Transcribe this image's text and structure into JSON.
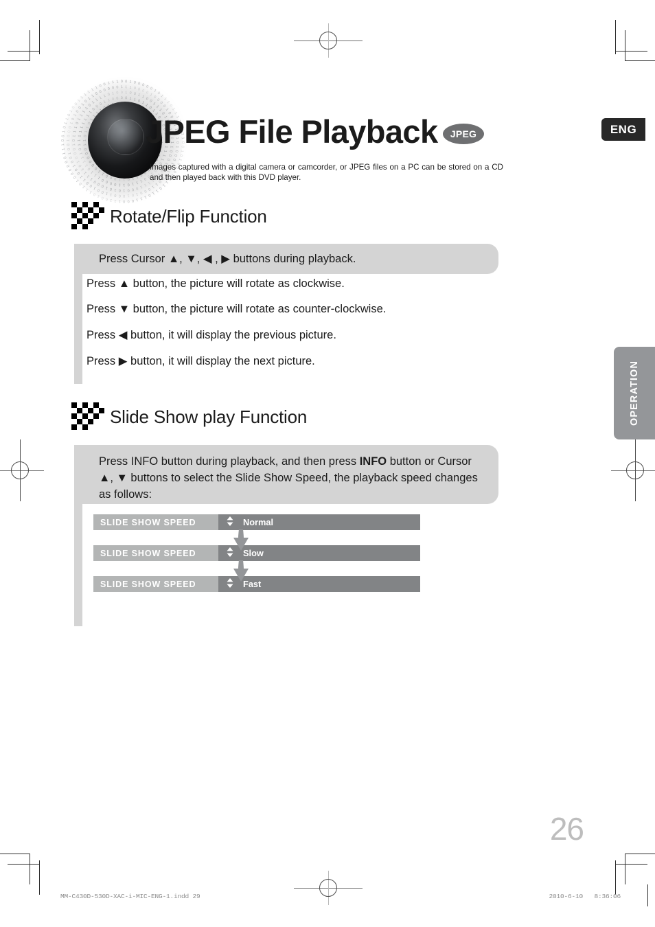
{
  "page": {
    "language_badge": "ENG",
    "side_tab_label": "OPERATION",
    "page_number": "26",
    "footer_file": "MM-C430D-530D-XAC-i-MIC-ENG-1.indd   29",
    "footer_date": "2010-6-10",
    "footer_time": "8:36:06"
  },
  "header": {
    "title": "JPEG File Playback",
    "format_badge": "JPEG",
    "intro": "Images captured with a digital camera or camcorder, or JPEG files on a PC can be stored on a CD and then played back with this DVD player."
  },
  "sections": [
    {
      "title": "Rotate/Flip Function",
      "callout": "Press Cursor ▲,  ▼,  ◀ ,  ▶ buttons during playback.",
      "lines": [
        "Press ▲ button, the picture will rotate as clockwise.",
        "Press ▼ button, the picture will rotate as counter-clockwise.",
        "Press ◀ button, it will display the previous picture.",
        "Press ▶ button, it will display the next picture."
      ]
    },
    {
      "title": "Slide Show play Function",
      "callout_part1": "Press INFO button during playback, and then press ",
      "callout_bold": "INFO",
      "callout_part2": " button or Cursor ▲,  ▼ buttons to select the Slide Show Speed,  the playback speed changes as follows:"
    }
  ],
  "slide_show_speed": {
    "label": "SLIDE SHOW SPEED",
    "stepper_icon": "up-down-arrow-icon",
    "options": [
      "Normal",
      "Slow",
      "Fast"
    ],
    "flow_icon": "down-arrow-icon"
  },
  "colors": {
    "callout_gray": "#d4d4d4",
    "bar_label_gray": "#b3b5b5",
    "bar_value_gray": "#828486",
    "side_tab_gray": "#949699",
    "badge_dark": "#282828",
    "page_number_gray": "#bdbdbd"
  }
}
